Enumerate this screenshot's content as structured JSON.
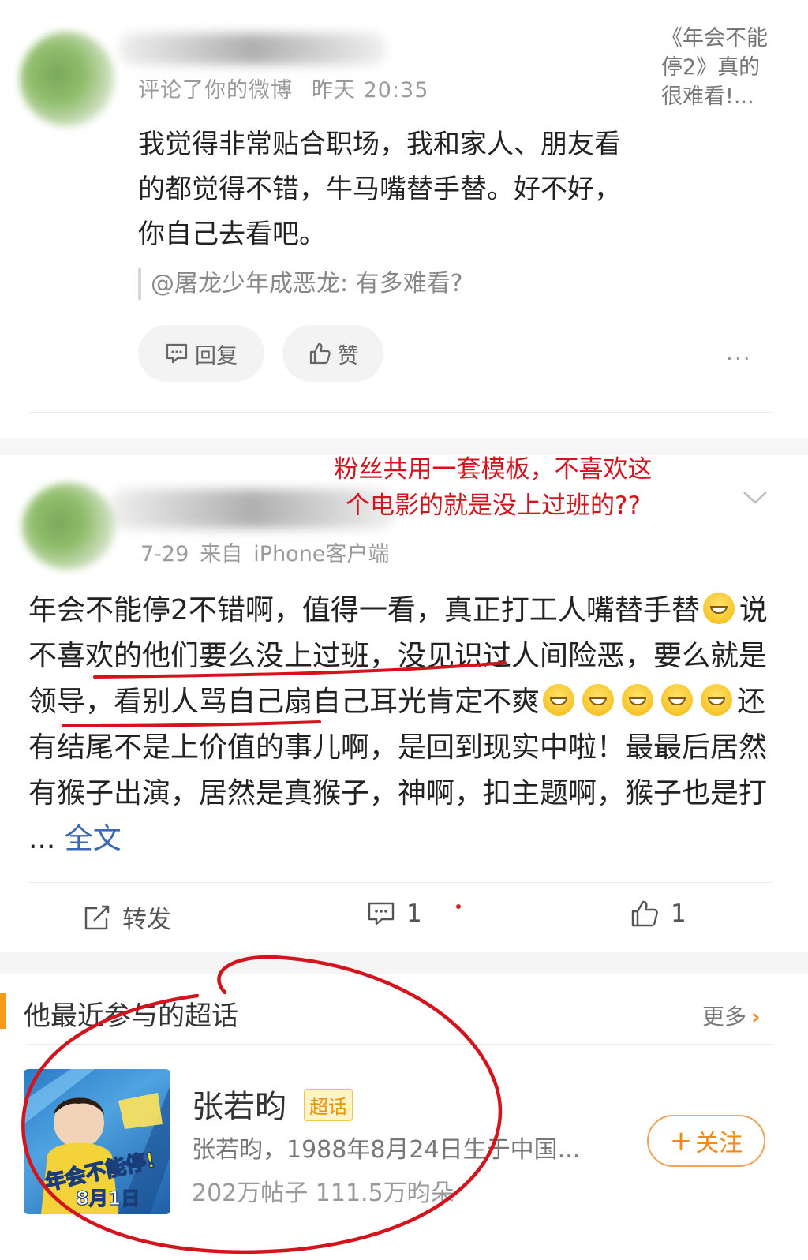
{
  "first_comment": {
    "meta_action": "评论了你的微博",
    "meta_time": "昨天 20:35",
    "ref_title": "《年会不能停2》真的很难看!...",
    "body": "我觉得非常贴合职场，我和家人、朋友看的都觉得不错，牛马嘴替手替。好不好，你自己去看吧。",
    "quote": "@屠龙少年成恶龙: 有多难看?",
    "reply_label": "回复",
    "like_label": "赞",
    "more_label": "..."
  },
  "annotation": "粉丝共用一套模板，不喜欢这个电影的就是没上过班的??",
  "second_post": {
    "meta_date": "7-29",
    "meta_source_prefix": "来自",
    "meta_source": "iPhone客户端",
    "body_line1": "年会不能停2不错啊，值得一看，真正打工人嘴替手替",
    "body_underlined": "说不喜欢的他们要么没上过班，没见识过人间险恶，要么就是领导",
    "body_line3": "，看别人骂自己扇自己耳光肯定不爽",
    "body_line4": "还有结尾不是上价值的事儿啊，是回到现实中啦！最最后居然有猴子出演，居然是真猴子，神啊，扣主题啊，猴子也是打",
    "ellipsis": " ... ",
    "full_text_link": "全文",
    "repost_label": "转发",
    "comment_count": "1",
    "like_count": "1"
  },
  "topics_section": {
    "title": "他最近参与的超话",
    "more_label": "更多",
    "topic": {
      "name": "张若昀",
      "badge": "超话",
      "description": "张若昀，1988年8月24日生于中国...",
      "stats": "202万帖子 111.5万昀朵",
      "follow_label": "关注",
      "thumb_text": "年会不能停!",
      "thumb_date": "8月1日"
    }
  },
  "colors": {
    "annotation_red": "#d4131c",
    "link_blue": "#3a67b6",
    "accent_orange": "#f28a15"
  },
  "icons": [
    "comment-icon",
    "thumbs-up-icon",
    "more-dots-icon",
    "chevron-down-icon",
    "repost-icon",
    "chevron-right-icon",
    "plus-icon",
    "grin-emoji-icon"
  ]
}
